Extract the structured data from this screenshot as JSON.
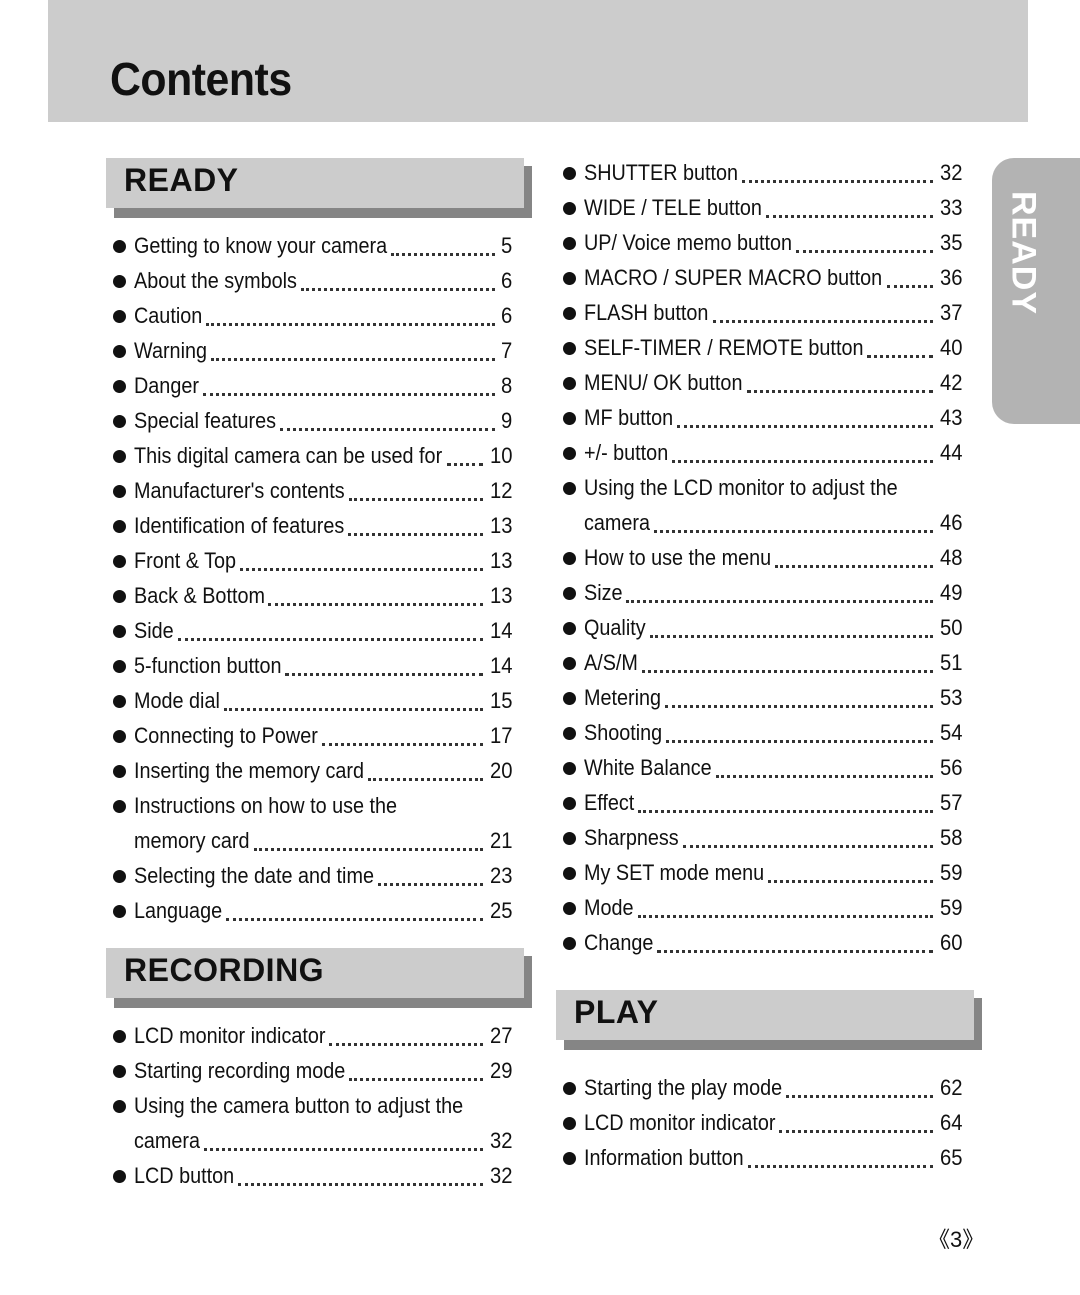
{
  "page_title": "Contents",
  "side_tab": "READY",
  "sections": {
    "ready": {
      "title": "READY",
      "items": [
        {
          "label": "Getting to know your camera",
          "page": "5"
        },
        {
          "label": "About the symbols",
          "page": "6"
        },
        {
          "label": "Caution",
          "page": "6"
        },
        {
          "label": "Warning",
          "page": "7"
        },
        {
          "label": "Danger",
          "page": "8"
        },
        {
          "label": "Special features",
          "page": "9"
        },
        {
          "label": "This digital camera can be used for",
          "page": "10"
        },
        {
          "label": "Manufacturer's contents",
          "page": "12"
        },
        {
          "label": "Identification of features",
          "page": "13"
        },
        {
          "label": "Front & Top",
          "page": "13"
        },
        {
          "label": "Back & Bottom",
          "page": "13"
        },
        {
          "label": "Side",
          "page": "14"
        },
        {
          "label": "5-function button",
          "page": "14"
        },
        {
          "label": "Mode dial",
          "page": "15"
        },
        {
          "label": "Connecting to Power",
          "page": "17"
        },
        {
          "label": "Inserting the memory card",
          "page": "20"
        },
        {
          "label": "Instructions on how to use the",
          "label_cont": "memory card",
          "page": "21"
        },
        {
          "label": "Selecting the date and time",
          "page": "23"
        },
        {
          "label": "Language",
          "page": "25"
        }
      ]
    },
    "recording": {
      "title": "RECORDING",
      "items": [
        {
          "label": "LCD monitor indicator",
          "page": "27"
        },
        {
          "label": "Starting recording mode",
          "page": "29"
        },
        {
          "label": "Using the camera button to adjust the",
          "label_cont": "camera",
          "page": "32"
        },
        {
          "label": "LCD button",
          "page": "32"
        }
      ]
    },
    "recording_cont": {
      "items": [
        {
          "label": "SHUTTER button",
          "page": "32"
        },
        {
          "label": "WIDE / TELE button",
          "page": "33"
        },
        {
          "label": "UP/ Voice memo button",
          "page": "35"
        },
        {
          "label": "MACRO / SUPER MACRO button",
          "page": "36"
        },
        {
          "label": "FLASH button",
          "page": "37"
        },
        {
          "label": "SELF-TIMER / REMOTE button",
          "page": "40"
        },
        {
          "label": "MENU/ OK button",
          "page": "42"
        },
        {
          "label": "MF button",
          "page": "43"
        },
        {
          "label": "+/- button",
          "page": "44"
        },
        {
          "label": "Using the LCD monitor to adjust the",
          "label_cont": "camera",
          "page": "46"
        },
        {
          "label": "How to use the menu",
          "page": "48"
        },
        {
          "label": "Size",
          "page": "49"
        },
        {
          "label": "Quality",
          "page": "50"
        },
        {
          "label": "A/S/M",
          "page": "51"
        },
        {
          "label": "Metering",
          "page": "53"
        },
        {
          "label": "Shooting",
          "page": "54"
        },
        {
          "label": "White Balance",
          "page": "56"
        },
        {
          "label": "Effect",
          "page": "57"
        },
        {
          "label": "Sharpness",
          "page": "58"
        },
        {
          "label": "My SET mode menu",
          "page": "59"
        },
        {
          "label": "Mode",
          "page": "59"
        },
        {
          "label": "Change",
          "page": "60"
        }
      ]
    },
    "play": {
      "title": "PLAY",
      "items": [
        {
          "label": "Starting the play mode",
          "page": "62"
        },
        {
          "label": "LCD monitor indicator",
          "page": "64"
        },
        {
          "label": "Information button",
          "page": "65"
        }
      ]
    }
  },
  "footer_page_number": "《3》"
}
